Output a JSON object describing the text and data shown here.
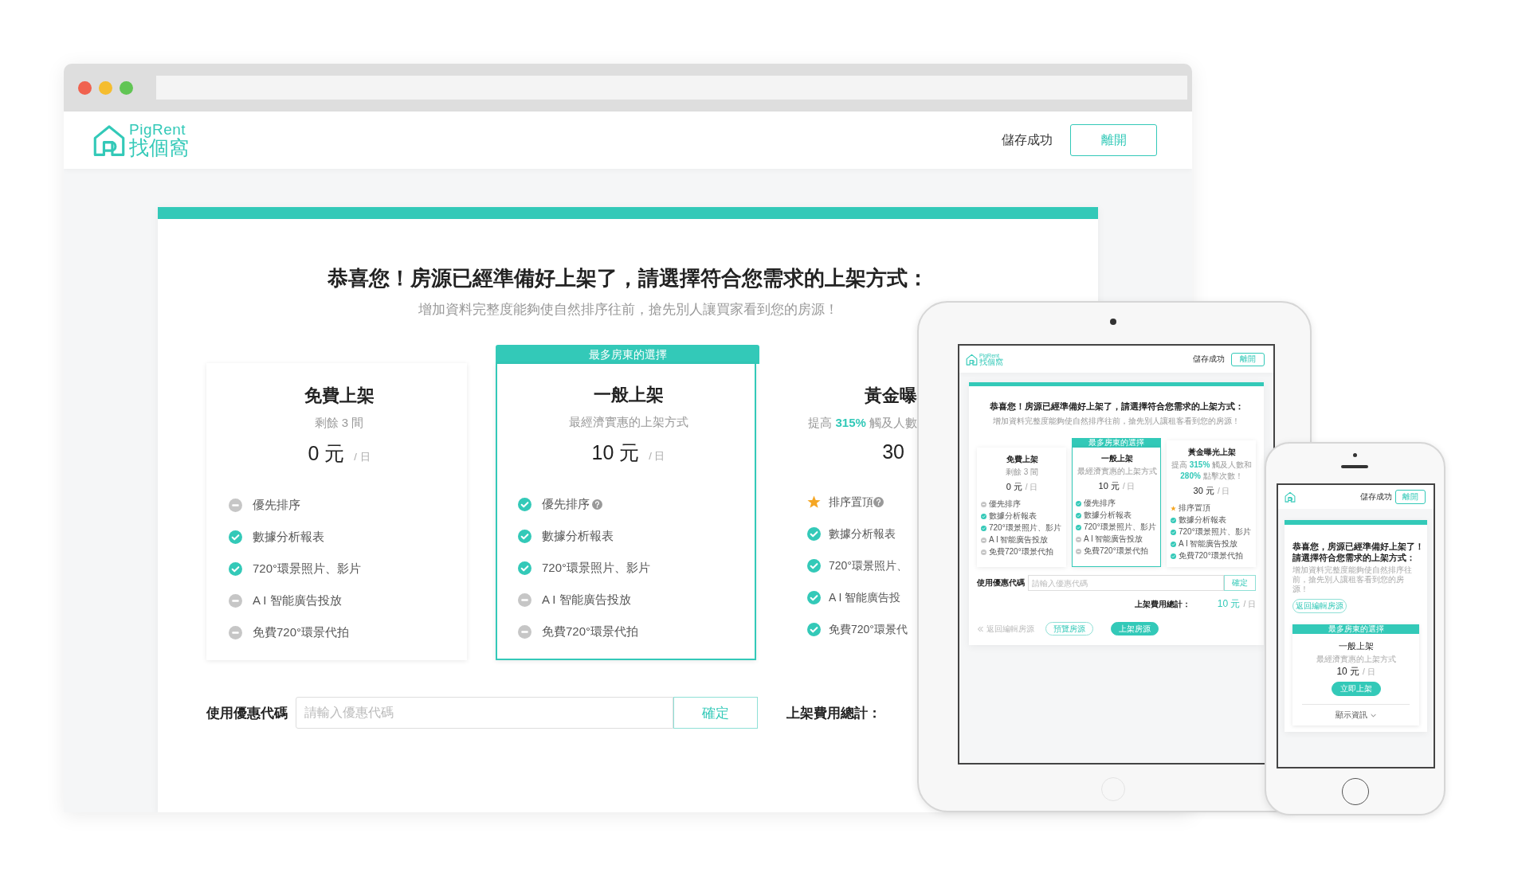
{
  "desktop": {
    "header": {
      "logo_name": "PigRent",
      "logo_tagline": "找個窩",
      "status": "儲存成功",
      "leave_button": "離開"
    },
    "title": "恭喜您！房源已經準備好上架了，請選擇符合您需求的上架方式：",
    "subtitle": "增加資料完整度能夠使自然排序往前，搶先別人讓買家看到您的房源！",
    "plans": [
      {
        "name": "免費上架",
        "note": [
          {
            "text": "剩餘 3 間",
            "highlight": false
          }
        ],
        "price": "0",
        "currency": "元",
        "per": "/ 日",
        "selected": false,
        "features": [
          {
            "label": "優先排序",
            "kind": "excluded",
            "help": false
          },
          {
            "label": "數據分析報表",
            "kind": "check",
            "help": false
          },
          {
            "label": "720°環景照片、影片",
            "kind": "check",
            "help": false
          },
          {
            "label": "A I 智能廣告投放",
            "kind": "excluded",
            "help": false
          },
          {
            "label": "免費720°環景代拍",
            "kind": "excluded",
            "help": false
          }
        ]
      },
      {
        "badge": "最多房東的選擇",
        "name": "一般上架",
        "note": [
          {
            "text": "最經濟實惠的上架方式",
            "highlight": false
          }
        ],
        "price": "10",
        "currency": "元",
        "per": "/ 日",
        "selected": true,
        "features": [
          {
            "label": "優先排序",
            "kind": "check",
            "help": true
          },
          {
            "label": "數據分析報表",
            "kind": "check",
            "help": false
          },
          {
            "label": "720°環景照片、影片",
            "kind": "check",
            "help": false
          },
          {
            "label": "A I 智能廣告投放",
            "kind": "excluded",
            "help": false
          },
          {
            "label": "免費720°環景代拍",
            "kind": "excluded",
            "help": false
          }
        ]
      },
      {
        "name": "黃金曝",
        "note": [
          {
            "text": "提高 ",
            "highlight": false
          },
          {
            "text": "315%",
            "highlight": true
          },
          {
            "text": " 觸及人數",
            "highlight": false
          }
        ],
        "price": "30",
        "selected": false,
        "features": [
          {
            "label": "排序置頂",
            "kind": "star",
            "help": true
          },
          {
            "label": "數據分析報表",
            "kind": "check",
            "help": false
          },
          {
            "label": "720°環景照片、",
            "kind": "check",
            "help": false
          },
          {
            "label": "A I 智能廣告投",
            "kind": "check",
            "help": false
          },
          {
            "label": "免費720°環景代",
            "kind": "check",
            "help": false
          }
        ]
      }
    ],
    "coupon": {
      "label": "使用優惠代碼",
      "placeholder": "請輸入優惠代碼",
      "button": "確定"
    },
    "total": {
      "label": "上架費用總計："
    }
  },
  "tablet": {
    "header": {
      "logo_name": "PigRent",
      "logo_tagline": "找個窩",
      "status": "儲存成功",
      "leave_button": "離開"
    },
    "title": "恭喜您！房源已經準備好上架了，請選擇符合您需求的上架方式：",
    "subtitle": "增加資料完整度能夠使自然排序往前，搶先別人讓租客看到您的房源！",
    "plans": [
      {
        "name": "免費上架",
        "note": [
          {
            "text": "剩餘 3 間",
            "highlight": false
          }
        ],
        "price": "0",
        "currency": "元",
        "per": "/ 日",
        "selected": false,
        "features": [
          {
            "label": "優先排序",
            "kind": "excluded",
            "help": false
          },
          {
            "label": "數據分析報表",
            "kind": "check",
            "help": false
          },
          {
            "label": "720°環景照片、影片",
            "kind": "check",
            "help": false
          },
          {
            "label": "A I 智能廣告投放",
            "kind": "excluded",
            "help": false
          },
          {
            "label": "免費720°環景代拍",
            "kind": "excluded",
            "help": false
          }
        ]
      },
      {
        "badge": "最多房東的選擇",
        "name": "一般上架",
        "note": [
          {
            "text": "最經濟實惠的上架方式",
            "highlight": false
          }
        ],
        "price": "10",
        "currency": "元",
        "per": "/ 日",
        "selected": true,
        "features": [
          {
            "label": "優先排序",
            "kind": "check",
            "help": false
          },
          {
            "label": "數據分析報表",
            "kind": "check",
            "help": false
          },
          {
            "label": "720°環景照片、影片",
            "kind": "check",
            "help": false
          },
          {
            "label": "A I 智能廣告投放",
            "kind": "excluded",
            "help": false
          },
          {
            "label": "免費720°環景代拍",
            "kind": "excluded",
            "help": false
          }
        ]
      },
      {
        "name": "黃金曝光上架",
        "note": [
          {
            "text": "提高 ",
            "highlight": false
          },
          {
            "text": "315%",
            "highlight": true
          },
          {
            "text": " 觸及人數和 ",
            "highlight": false
          },
          {
            "text": "280%",
            "highlight": true
          },
          {
            "text": " 點擊次數！",
            "highlight": false
          }
        ],
        "price": "30",
        "currency": "元",
        "per": "/ 日",
        "selected": false,
        "features": [
          {
            "label": "排序置頂",
            "kind": "star",
            "help": false
          },
          {
            "label": "數據分析報表",
            "kind": "check",
            "help": false
          },
          {
            "label": "720°環景照片、影片",
            "kind": "check",
            "help": false
          },
          {
            "label": "A I 智能廣告投放",
            "kind": "check",
            "help": false
          },
          {
            "label": "免費720°環景代拍",
            "kind": "check",
            "help": false
          }
        ]
      }
    ],
    "coupon": {
      "label": "使用優惠代碼",
      "placeholder": "請輸入優惠代碼",
      "button": "確定"
    },
    "total": {
      "label": "上架費用總計：",
      "value": "10",
      "currency": "元",
      "per": "/ 日"
    },
    "back_link": "返回編輯房源",
    "preview_button": "預覽房源",
    "publish_button": "上架房源"
  },
  "phone": {
    "header": {
      "status": "儲存成功",
      "leave_button": "離開"
    },
    "title_lines": [
      "恭喜您，房源已經準備好上架了！",
      "請選擇符合您需求的上架方式："
    ],
    "subtitle": "增加資料完整度能夠使自然排序往前，搶先別人讓租客看到您的房源！",
    "back_button": "返回編輯房源",
    "plan": {
      "badge": "最多房東的選擇",
      "name": "一般上架",
      "note": "最經濟實惠的上架方式",
      "price": "10",
      "currency": "元",
      "per": "/ 日",
      "action": "立即上架",
      "more": "顯示資訊"
    }
  }
}
